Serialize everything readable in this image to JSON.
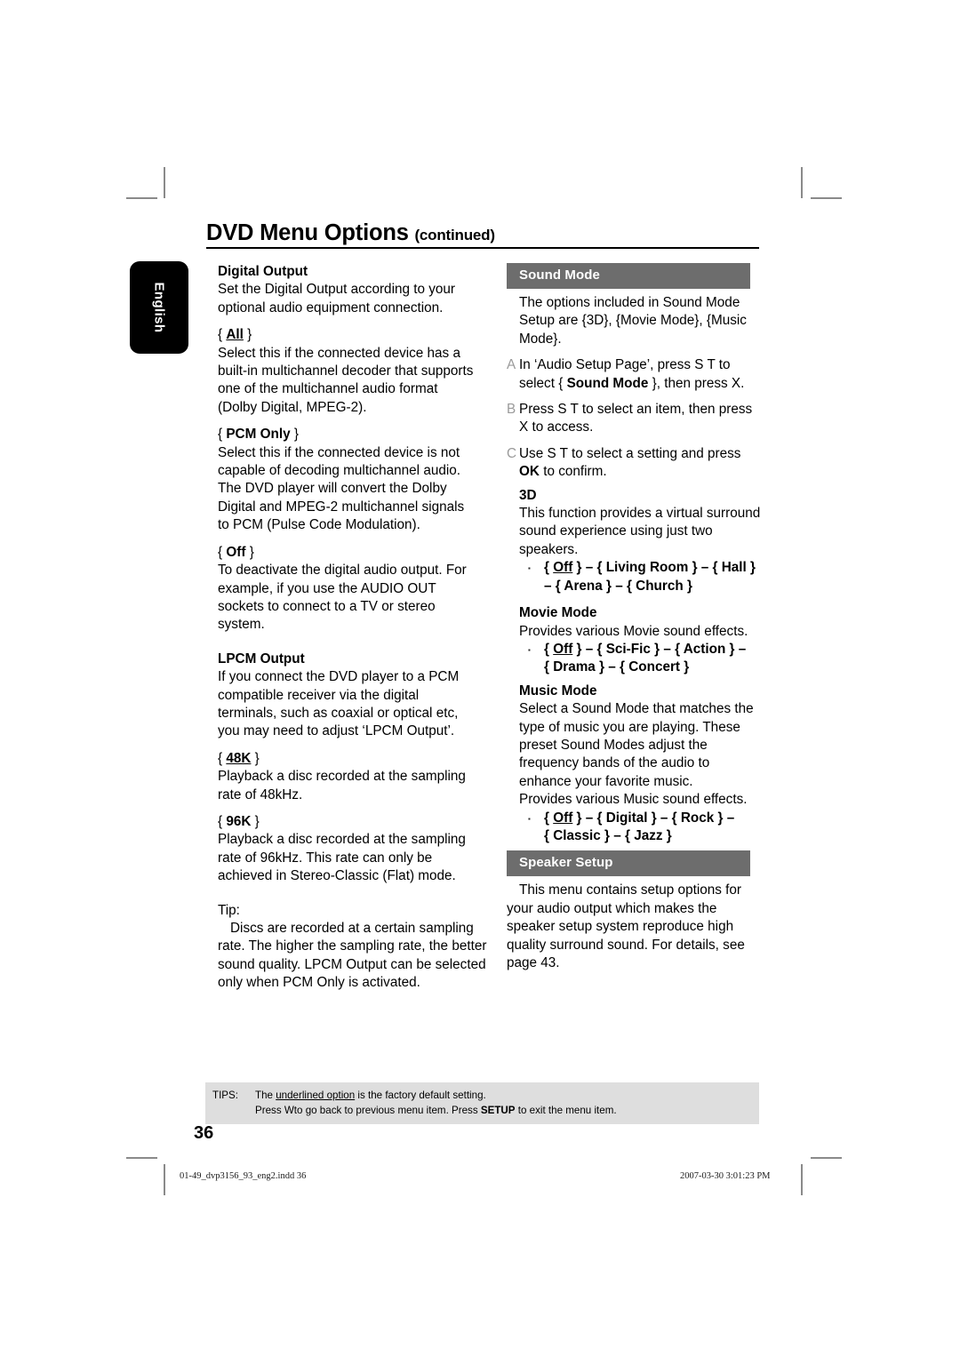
{
  "page": {
    "title_main": "DVD Menu Options",
    "title_continued": "(continued)",
    "language_tab": "English",
    "page_number": "36"
  },
  "left_column": {
    "digital_output": {
      "heading": "Digital Output",
      "intro": "Set the Digital Output according to your optional audio equipment connection.",
      "options": [
        {
          "label_open": "{ ",
          "label": "All",
          "label_close": " }",
          "underlined": true,
          "body": "Select this if the connected device has a built-in multichannel decoder that supports one of the multichannel audio format (Dolby Digital, MPEG-2)."
        },
        {
          "label_open": "{ ",
          "label": "PCM Only",
          "label_close": " }",
          "underlined": false,
          "body": "Select this if the connected device is not capable of decoding multichannel audio. The DVD player will convert the Dolby Digital and MPEG-2 multichannel signals to PCM (Pulse Code Modulation)."
        },
        {
          "label_open": "{ ",
          "label": "Off",
          "label_close": " }",
          "underlined": false,
          "body": "To deactivate the digital audio output. For example, if you use the AUDIO OUT sockets to connect to a TV or stereo system."
        }
      ]
    },
    "lpcm_output": {
      "heading": "LPCM Output",
      "intro": "If you connect the DVD player to a PCM compatible receiver via the digital terminals, such as coaxial or optical etc, you may need to adjust ‘LPCM Output’.",
      "options": [
        {
          "label_open": "{ ",
          "label": "48K",
          "label_close": " }",
          "underlined": true,
          "body": "Playback a disc recorded at the sampling rate of 48kHz."
        },
        {
          "label_open": "{ ",
          "label": "96K",
          "label_close": " }",
          "underlined": false,
          "body": "Playback a disc recorded at the sampling rate of 96kHz. This rate can only be achieved in Stereo-Classic (Flat) mode."
        }
      ]
    },
    "tip": {
      "label": "Tip:",
      "body": "Discs are recorded at a certain sampling rate. The higher the sampling rate, the better sound quality. LPCM Output can be selected only when PCM Only is activated."
    }
  },
  "right_column": {
    "sound_mode": {
      "bar_title": "Sound Mode",
      "intro": "The options included in Sound Mode Setup are {3D}, {Movie Mode}, {Music Mode}.",
      "steps": [
        {
          "letter": "A",
          "text_1": "In ‘Audio Setup Page’, press  S  T to select { ",
          "bold_1": "Sound Mode",
          "text_2": " }, then press  X."
        },
        {
          "letter": "B",
          "text_1": "Press  S  T to select an item, then press  X to access.",
          "bold_1": "",
          "text_2": ""
        },
        {
          "letter": "C",
          "text_1": "Use  S  T to select a setting and press ",
          "bold_1": "OK",
          "text_2": " to confirm."
        }
      ],
      "subsections": [
        {
          "heading": "3D",
          "body": "This function provides a virtual surround sound experience using just two speakers.",
          "options_line_1": "{ Off } – { Living Room } – { Hall }",
          "options_line_2": "– { Arena } – { Church }",
          "default_option": "Off"
        },
        {
          "heading": "Movie Mode",
          "body": "Provides various Movie sound effects.",
          "options_line_1": "{ Off } – { Sci-Fic } – { Action } –",
          "options_line_2": "{ Drama } – { Concert }",
          "default_option": "Off"
        },
        {
          "heading": "Music Mode",
          "body": "Select a Sound Mode that matches the type of music you are playing. These preset Sound Modes adjust the frequency bands of the audio to enhance your favorite music.",
          "body_2": "Provides various Music sound effects.",
          "options_line_1": "{ Off } – { Digital } – { Rock } –",
          "options_line_2": "{ Classic } – { Jazz }",
          "default_option": "Off"
        }
      ]
    },
    "speaker_setup": {
      "bar_title": "Speaker Setup",
      "body": "This menu contains setup options for your audio output which makes the speaker setup system reproduce high quality surround sound. For details, see page 43."
    }
  },
  "tips": {
    "label": "TIPS:",
    "line_1_pre": "The ",
    "line_1_underlined": "underlined option",
    "line_1_post": " is the factory default setting.",
    "line_2_pre": "Press  Wto go back to previous menu item. Press ",
    "line_2_bold": "SETUP",
    "line_2_post": " to exit the menu item."
  },
  "print_footer": {
    "file": "01-49_dvp3156_93_eng2.indd   36",
    "timestamp": "2007-03-30   3:01:23 PM"
  },
  "colors": {
    "section_bar": "#6d6d6d",
    "tips_background": "#dedede",
    "step_letter": "#9a9a9a",
    "crop_mark": "#8a8a8a"
  }
}
